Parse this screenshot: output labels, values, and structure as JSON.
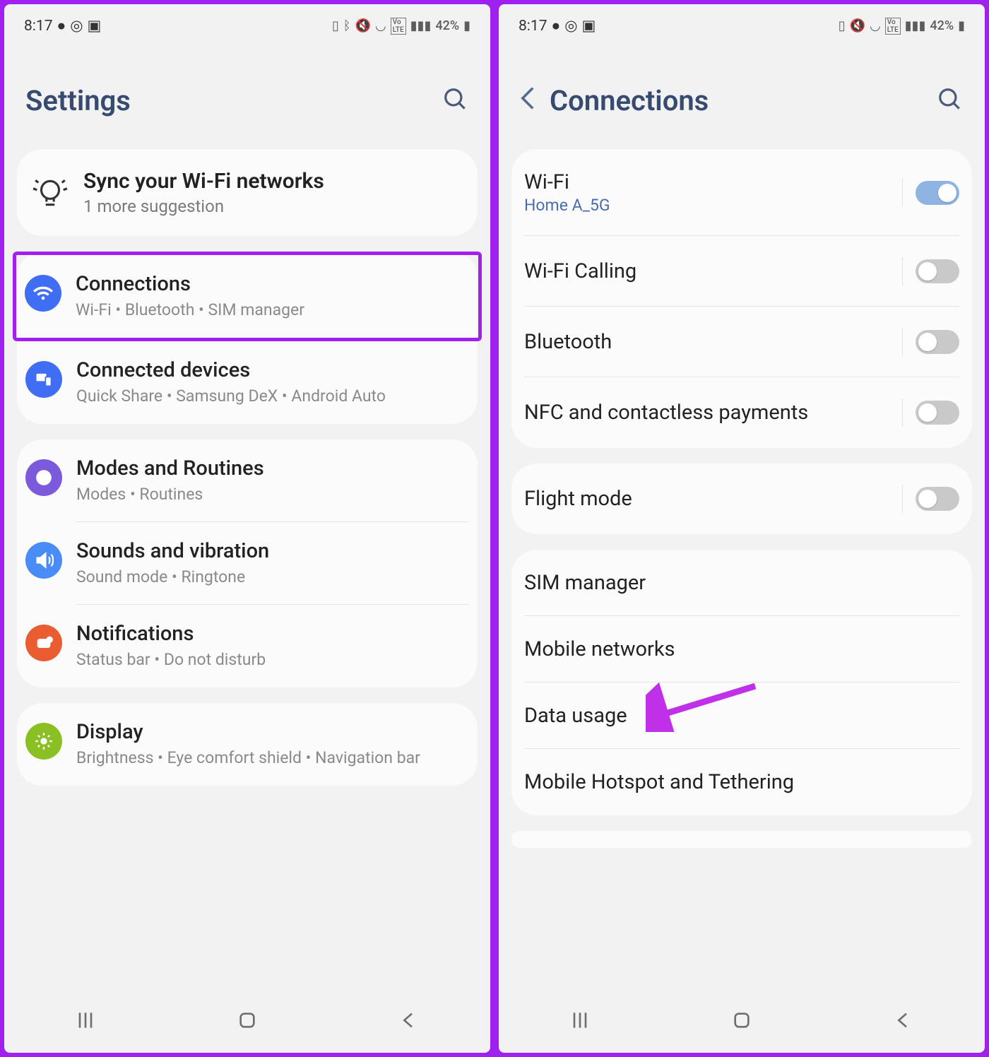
{
  "status": {
    "time": "8:17",
    "left_icons": [
      "chat-icon",
      "instagram-icon",
      "image-icon"
    ],
    "right_icons_p1": [
      "battery-saver-icon",
      "bluetooth-icon",
      "mute-icon",
      "wifi-icon",
      "volte-icon",
      "signal-icon"
    ],
    "right_icons_p2": [
      "battery-saver-icon",
      "mute-icon",
      "wifi-icon",
      "volte-icon",
      "signal-icon"
    ],
    "battery": "42%"
  },
  "left": {
    "title": "Settings",
    "sync": {
      "title": "Sync your Wi-Fi networks",
      "sub": "1 more suggestion"
    },
    "groups": [
      {
        "items": [
          {
            "key": "connections",
            "title": "Connections",
            "sub": "Wi-Fi  •  Bluetooth  •  SIM manager",
            "color": "bg-blue",
            "highlighted": true
          },
          {
            "key": "connected-devices",
            "title": "Connected devices",
            "sub": "Quick Share  •  Samsung DeX  •  Android Auto",
            "color": "bg-blue"
          }
        ]
      },
      {
        "items": [
          {
            "key": "modes-routines",
            "title": "Modes and Routines",
            "sub": "Modes  •  Routines",
            "color": "bg-purple"
          },
          {
            "key": "sounds-vibration",
            "title": "Sounds and vibration",
            "sub": "Sound mode  •  Ringtone",
            "color": "bg-lightblue"
          },
          {
            "key": "notifications",
            "title": "Notifications",
            "sub": "Status bar  •  Do not disturb",
            "color": "bg-orange"
          }
        ]
      },
      {
        "items": [
          {
            "key": "display",
            "title": "Display",
            "sub": "Brightness  •  Eye comfort shield  •  Navigation bar",
            "color": "bg-green"
          }
        ]
      }
    ]
  },
  "right": {
    "title": "Connections",
    "groups": [
      {
        "rows": [
          {
            "key": "wifi",
            "title": "Wi-Fi",
            "sub": "Home A_5G",
            "toggle": "on",
            "divider": true
          },
          {
            "key": "wifi-calling",
            "title": "Wi-Fi Calling",
            "toggle": "off",
            "divider": true
          },
          {
            "key": "bluetooth",
            "title": "Bluetooth",
            "toggle": "off",
            "divider": true
          },
          {
            "key": "nfc",
            "title": "NFC and contactless payments",
            "toggle": "off",
            "divider": true
          }
        ]
      },
      {
        "rows": [
          {
            "key": "flight-mode",
            "title": "Flight mode",
            "toggle": "off",
            "divider": true
          }
        ]
      },
      {
        "rows": [
          {
            "key": "sim-manager",
            "title": "SIM manager"
          },
          {
            "key": "mobile-networks",
            "title": "Mobile networks"
          },
          {
            "key": "data-usage",
            "title": "Data usage",
            "arrow": true
          },
          {
            "key": "mobile-hotspot",
            "title": "Mobile Hotspot and Tethering"
          }
        ]
      }
    ]
  }
}
